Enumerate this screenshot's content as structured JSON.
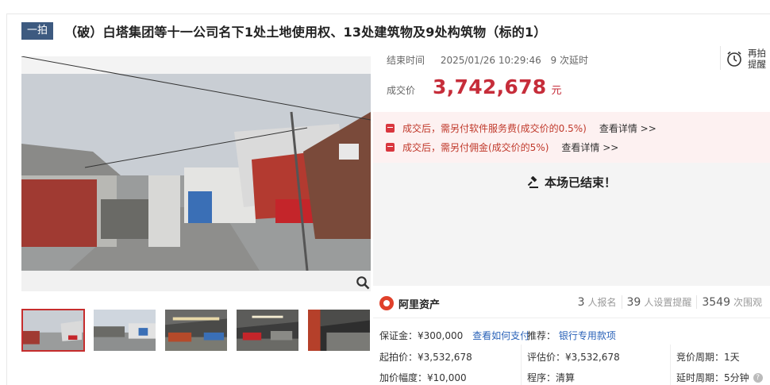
{
  "header": {
    "tag": "一拍",
    "title": "（破）白塔集团等十一公司名下1处土地使用权、13处建筑物及9处构筑物（标的1）"
  },
  "auction": {
    "end_label": "结束时间",
    "end_time": "2025/01/26 10:29:46",
    "delay_count": "9 次延时",
    "remind_label": "再拍提醒",
    "price_label": "成交价",
    "price_value": "3,742,678",
    "price_unit": "元",
    "notices": [
      {
        "text": "成交后，需另付软件服务费(成交价的0.5%)",
        "link": "查看详情 >>"
      },
      {
        "text": "成交后，需另付佣金(成交价的5%)",
        "link": "查看详情 >>"
      }
    ],
    "ended_text": "本场已结束！"
  },
  "platform": {
    "name": "阿里资产",
    "stats": [
      {
        "num": "3",
        "label": "人报名"
      },
      {
        "num": "39",
        "label": "人设置提醒"
      },
      {
        "num": "3549",
        "label": "次围观"
      }
    ]
  },
  "info": {
    "deposit": "保证金：¥300,000",
    "deposit_link": "查看如何支付",
    "recommend_label": "推荐：",
    "recommend_link": "银行专用款项",
    "start_price": "起拍价：¥3,532,678",
    "appraisal": "评估价：¥3,532,678",
    "period": "竞价周期：1天",
    "increment": "加价幅度：¥10,000",
    "procedure": "程序：清算",
    "delay_period": "延时周期：5分钟"
  },
  "colors": {
    "accent": "#c62d3a",
    "tag_bg": "#3d5a80",
    "link": "#2a62b8"
  }
}
